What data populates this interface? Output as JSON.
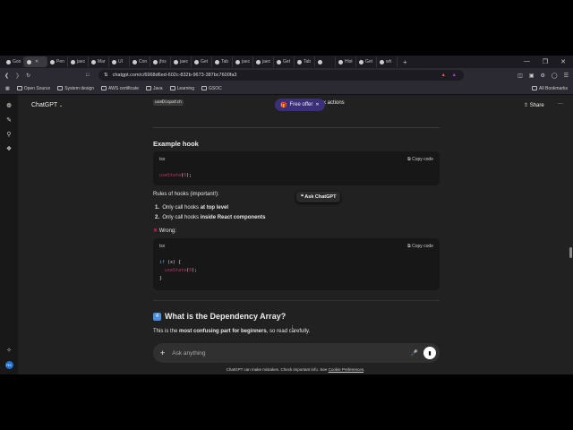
{
  "browser": {
    "tabs": [
      "Goo",
      "",
      "Pen",
      "jaec",
      "Mar",
      "UI",
      "Con",
      "jfos",
      "jaec",
      "Get",
      "Tab",
      "jaec",
      "jaec",
      "Get",
      "Tab",
      "",
      "Hist",
      "Get",
      "wh"
    ],
    "new_tab": "+",
    "url": "chatgpt.com/c/6968d6ed-602c-832b-9673-387bc7600fa3",
    "bookmarks": [
      "Open Source",
      "System design",
      "AWS certificate",
      "Java",
      "Learning",
      "GSOC"
    ],
    "all_bookmarks": "All Bookmarks"
  },
  "header": {
    "model": "ChatGPT",
    "share": "Share",
    "free_offer": "Free offer",
    "partial_text": "x actions"
  },
  "content": {
    "tag": "useDispatch",
    "example_heading": "Example hook",
    "code1": {
      "lang": "tsx",
      "copy": "Copy code",
      "fn": "useState",
      "arg": "0"
    },
    "rules_heading": "Rules of hooks (important!):",
    "rules": [
      {
        "n": "1.",
        "pre": "Only call hooks ",
        "bold": "at top level"
      },
      {
        "n": "2.",
        "pre": "Only call hooks ",
        "bold": "inside React components"
      }
    ],
    "wrong": "Wrong:",
    "code2": {
      "lang": "tsx",
      "copy": "Copy code",
      "line1_kw": "if",
      "line1_rest": " (x) {",
      "fn": "useState",
      "arg": "0",
      "close": "}"
    },
    "ask_chatgpt": "Ask ChatGPT",
    "section_emoji": "4",
    "section_heading": "What is the Dependency Array?",
    "section_text_pre": "This is the ",
    "section_text_bold": "most confusing part for beginners",
    "section_text_post": ", so read carefully."
  },
  "composer": {
    "placeholder": "Ask anything"
  },
  "footer": {
    "text": "ChatGPT can make mistakes. Check important info. See ",
    "link": "Cookie Preferences",
    "end": "."
  },
  "user": {
    "initials": "RS"
  }
}
